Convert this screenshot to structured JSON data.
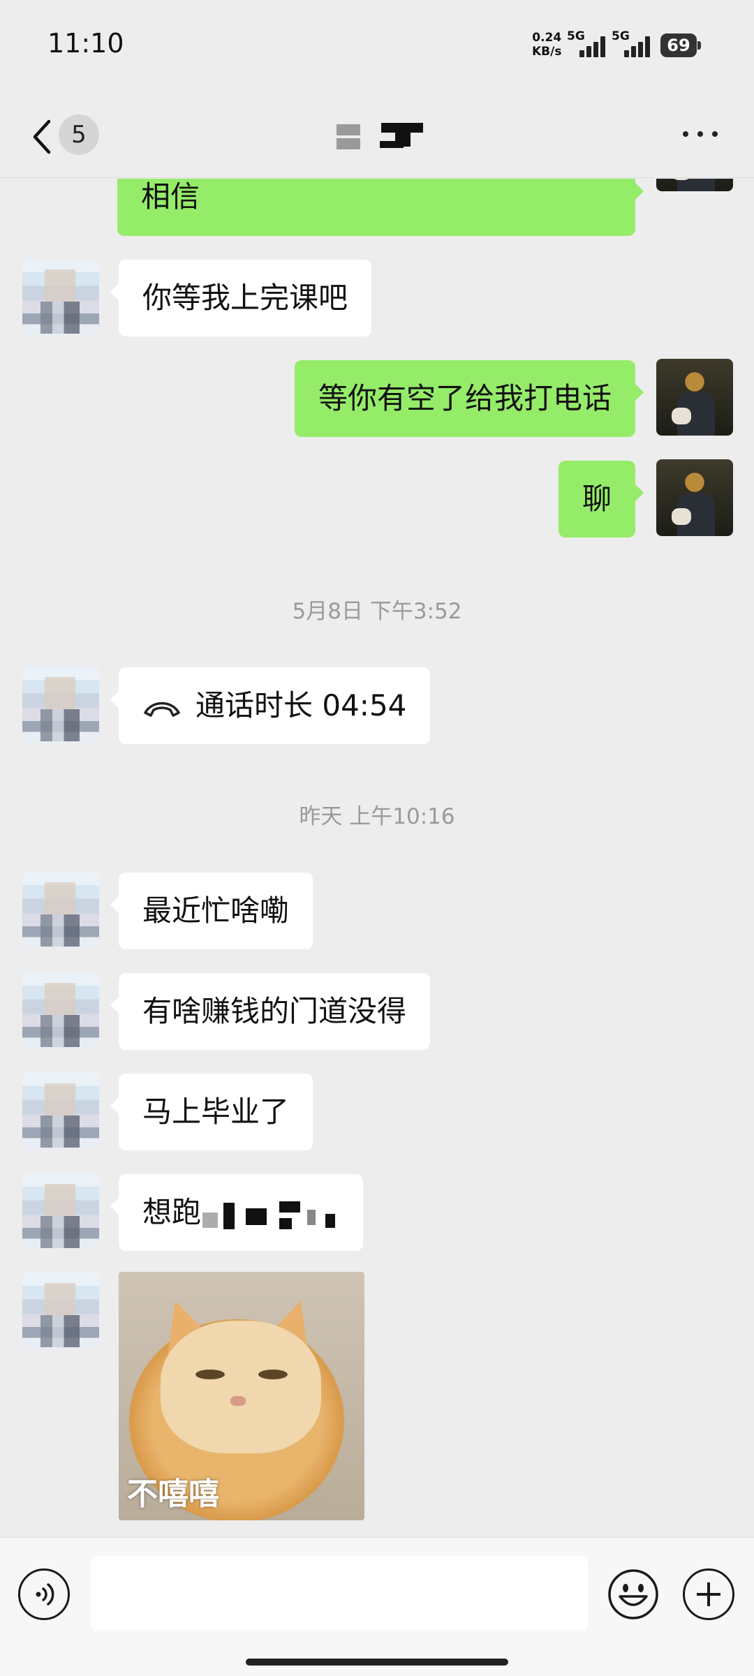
{
  "status_bar": {
    "time": "11:10",
    "net_speed_value": "0.24",
    "net_speed_unit": "KB/s",
    "signal1_label": "5G",
    "signal2_label": "5G",
    "battery": "69"
  },
  "header": {
    "unread_count": "5",
    "contact_name": "",
    "more_icon": "more-icon"
  },
  "messages": [
    {
      "side": "out",
      "text": "相信"
    },
    {
      "side": "in",
      "text": "你等我上完课吧"
    },
    {
      "side": "out",
      "text": "等你有空了给我打电话"
    },
    {
      "side": "out",
      "text": "聊"
    },
    {
      "type": "timestamp",
      "text": "5月8日 下午3:52"
    },
    {
      "side": "in",
      "type": "call",
      "text": "通话时长 04:54"
    },
    {
      "type": "timestamp",
      "text": "昨天 上午10:16"
    },
    {
      "side": "in",
      "text": "最近忙啥嘞"
    },
    {
      "side": "in",
      "text": "有啥赚钱的门道没得"
    },
    {
      "side": "in",
      "text": "马上毕业了"
    },
    {
      "side": "in",
      "text": "想跑"
    },
    {
      "side": "in",
      "type": "sticker",
      "caption": "不嘻嘻"
    }
  ],
  "input_bar": {
    "voice_icon": "voice-icon",
    "emoji_icon": "emoji-icon",
    "plus_icon": "plus-icon",
    "input_value": ""
  },
  "colors": {
    "background": "#ededed",
    "outgoing_bubble": "#95ec69",
    "incoming_bubble": "#ffffff",
    "timestamp_text": "#9a9a9a"
  }
}
